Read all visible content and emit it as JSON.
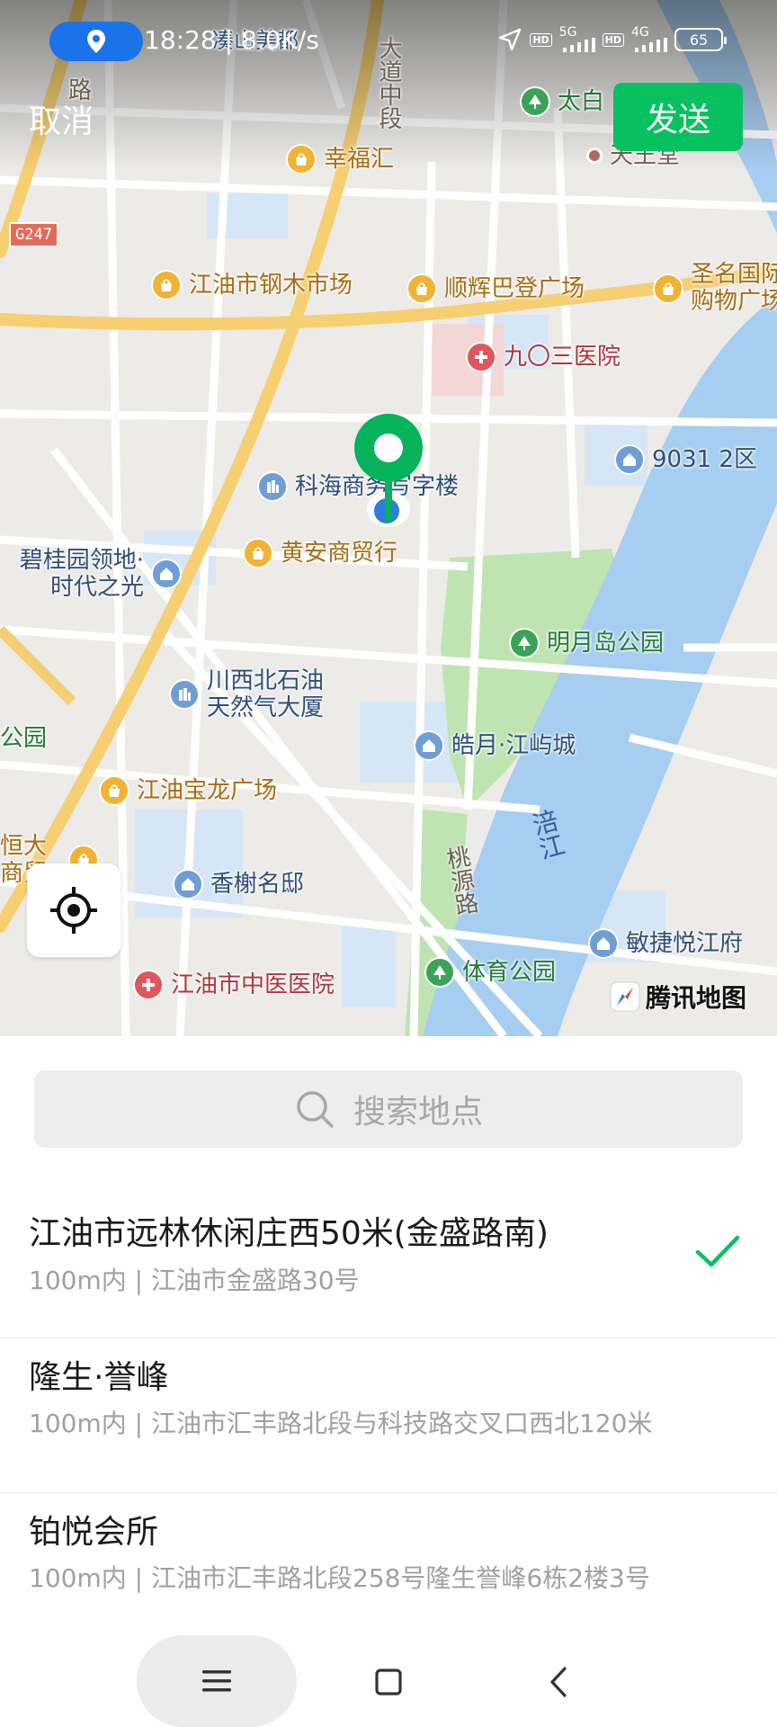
{
  "status_bar": {
    "time_speed": "18:28 | 8.0K/s",
    "network_1": "5G",
    "network_2": "4G",
    "hd_label": "HD",
    "battery": "65"
  },
  "header": {
    "cancel_label": "取消",
    "send_label": "发送"
  },
  "map": {
    "route_shield": "G247",
    "river_label": "涪江",
    "road_labels": {
      "dadao": "大道中段",
      "lu": "路",
      "taoyuan": "桃源路"
    },
    "attribution": "腾讯地图",
    "pois": [
      {
        "id": "xingfu",
        "label": "幸福汇",
        "color": "orange"
      },
      {
        "id": "gangmu",
        "label": "江油市钢木市场",
        "color": "orange"
      },
      {
        "id": "shunhui",
        "label": "顺辉巴登广场",
        "color": "orange"
      },
      {
        "id": "shengming",
        "label": "圣名国际购物广场",
        "color": "orange"
      },
      {
        "id": "hospital903",
        "label": "九〇三医院",
        "color": "red"
      },
      {
        "id": "q9031",
        "label": "9031 2区",
        "color": "blue"
      },
      {
        "id": "kehai",
        "label": "科海商务写字楼",
        "color": "blue"
      },
      {
        "id": "huangan",
        "label": "黄安商贸行",
        "color": "orange"
      },
      {
        "id": "biguiyuan",
        "label": "碧桂园领地·时代之光",
        "color": "blue"
      },
      {
        "id": "mingyuedao",
        "label": "明月岛公园",
        "color": "green"
      },
      {
        "id": "chuanxi",
        "label": "川西北石油天然气大厦",
        "color": "blue"
      },
      {
        "id": "haoyue",
        "label": "皓月·江屿城",
        "color": "blue"
      },
      {
        "id": "gongyuan_left",
        "label": "公园",
        "color": "green"
      },
      {
        "id": "baolong",
        "label": "江油宝龙广场",
        "color": "orange"
      },
      {
        "id": "hengda",
        "label": "恒大商贸",
        "color": "orange"
      },
      {
        "id": "xiangxie",
        "label": "香榭名邸",
        "color": "blue"
      },
      {
        "id": "minjie",
        "label": "敏捷悦江府",
        "color": "blue"
      },
      {
        "id": "tiyu",
        "label": "体育公园",
        "color": "green"
      },
      {
        "id": "zhongyi",
        "label": "江油市中医医院",
        "color": "red"
      },
      {
        "id": "taibai",
        "label": "太白",
        "color": "green"
      },
      {
        "id": "tianwang",
        "label": "天王堂",
        "color": "red"
      },
      {
        "id": "top_partial",
        "label": "凑山美都",
        "color": "blue"
      }
    ]
  },
  "search": {
    "placeholder": "搜索地点"
  },
  "results": [
    {
      "title": "江油市远林休闲庄西50米(金盛路南)",
      "sub": "100m内 | 江油市金盛路30号",
      "selected": true
    },
    {
      "title": "隆生·誉峰",
      "sub": "100m内 | 江油市汇丰路北段与科技路交叉口西北120米",
      "selected": false
    },
    {
      "title": "铂悦会所",
      "sub": "100m内 | 江油市汇丰路北段258号隆生誉峰6栋2楼3号",
      "selected": false
    }
  ],
  "colors": {
    "accent": "#07c160",
    "pin": "#07b35a",
    "river": "#a7cdf0",
    "park": "#bfe4b2",
    "road_major": "#f6cf72"
  },
  "icons": {
    "menu": "menu-icon",
    "home": "home-icon",
    "back": "back-icon",
    "locate": "locate-icon",
    "search": "search-icon",
    "check": "check-icon"
  }
}
